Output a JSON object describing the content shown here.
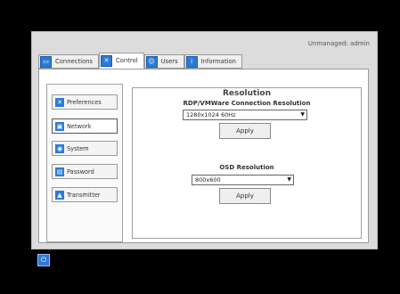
{
  "header": {
    "user_status": "Unmanaged: admin"
  },
  "tabs": [
    {
      "label": "Connections",
      "icon": "connections-icon"
    },
    {
      "label": "Control",
      "icon": "tools-icon"
    },
    {
      "label": "Users",
      "icon": "users-icon"
    },
    {
      "label": "Information",
      "icon": "info-icon"
    }
  ],
  "sidebar": {
    "items": [
      {
        "label": "Preferences",
        "icon": "tools-icon"
      },
      {
        "label": "Network",
        "icon": "network-icon"
      },
      {
        "label": "System",
        "icon": "system-icon"
      },
      {
        "label": "Password",
        "icon": "lock-icon"
      },
      {
        "label": "Transmitter",
        "icon": "transmitter-icon"
      }
    ]
  },
  "resolution": {
    "title": "Resolution",
    "rdp_label": "RDP/VMWare Connection Resolution",
    "rdp_value": "1280x1024 60Hz",
    "rdp_apply": "Apply",
    "osd_label": "OSD Resolution",
    "osd_value": "800x600",
    "osd_apply": "Apply"
  },
  "colors": {
    "accent": "#2b7bd6"
  }
}
